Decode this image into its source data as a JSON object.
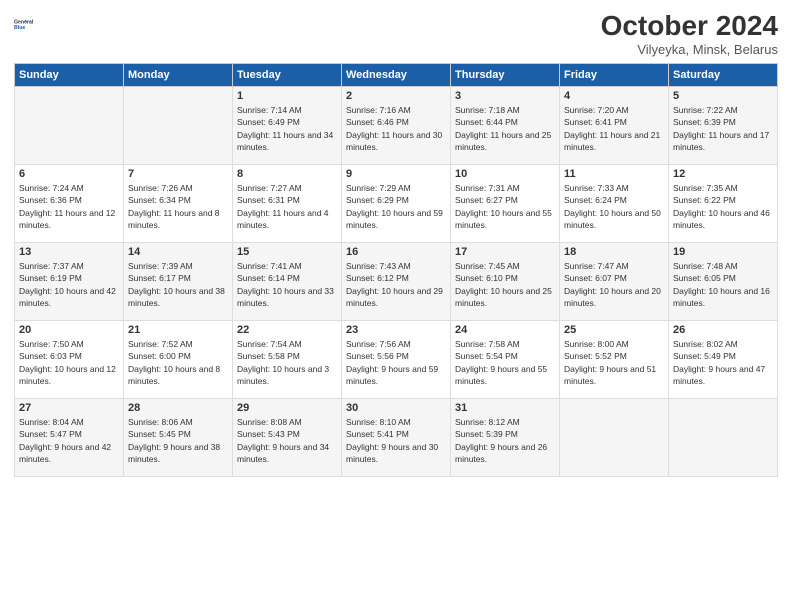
{
  "header": {
    "logo_line1": "General",
    "logo_line2": "Blue",
    "month": "October 2024",
    "location": "Vilyeyka, Minsk, Belarus"
  },
  "days_of_week": [
    "Sunday",
    "Monday",
    "Tuesday",
    "Wednesday",
    "Thursday",
    "Friday",
    "Saturday"
  ],
  "weeks": [
    [
      {
        "day": "",
        "sunrise": "",
        "sunset": "",
        "daylight": ""
      },
      {
        "day": "",
        "sunrise": "",
        "sunset": "",
        "daylight": ""
      },
      {
        "day": "1",
        "sunrise": "Sunrise: 7:14 AM",
        "sunset": "Sunset: 6:49 PM",
        "daylight": "Daylight: 11 hours and 34 minutes."
      },
      {
        "day": "2",
        "sunrise": "Sunrise: 7:16 AM",
        "sunset": "Sunset: 6:46 PM",
        "daylight": "Daylight: 11 hours and 30 minutes."
      },
      {
        "day": "3",
        "sunrise": "Sunrise: 7:18 AM",
        "sunset": "Sunset: 6:44 PM",
        "daylight": "Daylight: 11 hours and 25 minutes."
      },
      {
        "day": "4",
        "sunrise": "Sunrise: 7:20 AM",
        "sunset": "Sunset: 6:41 PM",
        "daylight": "Daylight: 11 hours and 21 minutes."
      },
      {
        "day": "5",
        "sunrise": "Sunrise: 7:22 AM",
        "sunset": "Sunset: 6:39 PM",
        "daylight": "Daylight: 11 hours and 17 minutes."
      }
    ],
    [
      {
        "day": "6",
        "sunrise": "Sunrise: 7:24 AM",
        "sunset": "Sunset: 6:36 PM",
        "daylight": "Daylight: 11 hours and 12 minutes."
      },
      {
        "day": "7",
        "sunrise": "Sunrise: 7:26 AM",
        "sunset": "Sunset: 6:34 PM",
        "daylight": "Daylight: 11 hours and 8 minutes."
      },
      {
        "day": "8",
        "sunrise": "Sunrise: 7:27 AM",
        "sunset": "Sunset: 6:31 PM",
        "daylight": "Daylight: 11 hours and 4 minutes."
      },
      {
        "day": "9",
        "sunrise": "Sunrise: 7:29 AM",
        "sunset": "Sunset: 6:29 PM",
        "daylight": "Daylight: 10 hours and 59 minutes."
      },
      {
        "day": "10",
        "sunrise": "Sunrise: 7:31 AM",
        "sunset": "Sunset: 6:27 PM",
        "daylight": "Daylight: 10 hours and 55 minutes."
      },
      {
        "day": "11",
        "sunrise": "Sunrise: 7:33 AM",
        "sunset": "Sunset: 6:24 PM",
        "daylight": "Daylight: 10 hours and 50 minutes."
      },
      {
        "day": "12",
        "sunrise": "Sunrise: 7:35 AM",
        "sunset": "Sunset: 6:22 PM",
        "daylight": "Daylight: 10 hours and 46 minutes."
      }
    ],
    [
      {
        "day": "13",
        "sunrise": "Sunrise: 7:37 AM",
        "sunset": "Sunset: 6:19 PM",
        "daylight": "Daylight: 10 hours and 42 minutes."
      },
      {
        "day": "14",
        "sunrise": "Sunrise: 7:39 AM",
        "sunset": "Sunset: 6:17 PM",
        "daylight": "Daylight: 10 hours and 38 minutes."
      },
      {
        "day": "15",
        "sunrise": "Sunrise: 7:41 AM",
        "sunset": "Sunset: 6:14 PM",
        "daylight": "Daylight: 10 hours and 33 minutes."
      },
      {
        "day": "16",
        "sunrise": "Sunrise: 7:43 AM",
        "sunset": "Sunset: 6:12 PM",
        "daylight": "Daylight: 10 hours and 29 minutes."
      },
      {
        "day": "17",
        "sunrise": "Sunrise: 7:45 AM",
        "sunset": "Sunset: 6:10 PM",
        "daylight": "Daylight: 10 hours and 25 minutes."
      },
      {
        "day": "18",
        "sunrise": "Sunrise: 7:47 AM",
        "sunset": "Sunset: 6:07 PM",
        "daylight": "Daylight: 10 hours and 20 minutes."
      },
      {
        "day": "19",
        "sunrise": "Sunrise: 7:48 AM",
        "sunset": "Sunset: 6:05 PM",
        "daylight": "Daylight: 10 hours and 16 minutes."
      }
    ],
    [
      {
        "day": "20",
        "sunrise": "Sunrise: 7:50 AM",
        "sunset": "Sunset: 6:03 PM",
        "daylight": "Daylight: 10 hours and 12 minutes."
      },
      {
        "day": "21",
        "sunrise": "Sunrise: 7:52 AM",
        "sunset": "Sunset: 6:00 PM",
        "daylight": "Daylight: 10 hours and 8 minutes."
      },
      {
        "day": "22",
        "sunrise": "Sunrise: 7:54 AM",
        "sunset": "Sunset: 5:58 PM",
        "daylight": "Daylight: 10 hours and 3 minutes."
      },
      {
        "day": "23",
        "sunrise": "Sunrise: 7:56 AM",
        "sunset": "Sunset: 5:56 PM",
        "daylight": "Daylight: 9 hours and 59 minutes."
      },
      {
        "day": "24",
        "sunrise": "Sunrise: 7:58 AM",
        "sunset": "Sunset: 5:54 PM",
        "daylight": "Daylight: 9 hours and 55 minutes."
      },
      {
        "day": "25",
        "sunrise": "Sunrise: 8:00 AM",
        "sunset": "Sunset: 5:52 PM",
        "daylight": "Daylight: 9 hours and 51 minutes."
      },
      {
        "day": "26",
        "sunrise": "Sunrise: 8:02 AM",
        "sunset": "Sunset: 5:49 PM",
        "daylight": "Daylight: 9 hours and 47 minutes."
      }
    ],
    [
      {
        "day": "27",
        "sunrise": "Sunrise: 8:04 AM",
        "sunset": "Sunset: 5:47 PM",
        "daylight": "Daylight: 9 hours and 42 minutes."
      },
      {
        "day": "28",
        "sunrise": "Sunrise: 8:06 AM",
        "sunset": "Sunset: 5:45 PM",
        "daylight": "Daylight: 9 hours and 38 minutes."
      },
      {
        "day": "29",
        "sunrise": "Sunrise: 8:08 AM",
        "sunset": "Sunset: 5:43 PM",
        "daylight": "Daylight: 9 hours and 34 minutes."
      },
      {
        "day": "30",
        "sunrise": "Sunrise: 8:10 AM",
        "sunset": "Sunset: 5:41 PM",
        "daylight": "Daylight: 9 hours and 30 minutes."
      },
      {
        "day": "31",
        "sunrise": "Sunrise: 8:12 AM",
        "sunset": "Sunset: 5:39 PM",
        "daylight": "Daylight: 9 hours and 26 minutes."
      },
      {
        "day": "",
        "sunrise": "",
        "sunset": "",
        "daylight": ""
      },
      {
        "day": "",
        "sunrise": "",
        "sunset": "",
        "daylight": ""
      }
    ]
  ]
}
